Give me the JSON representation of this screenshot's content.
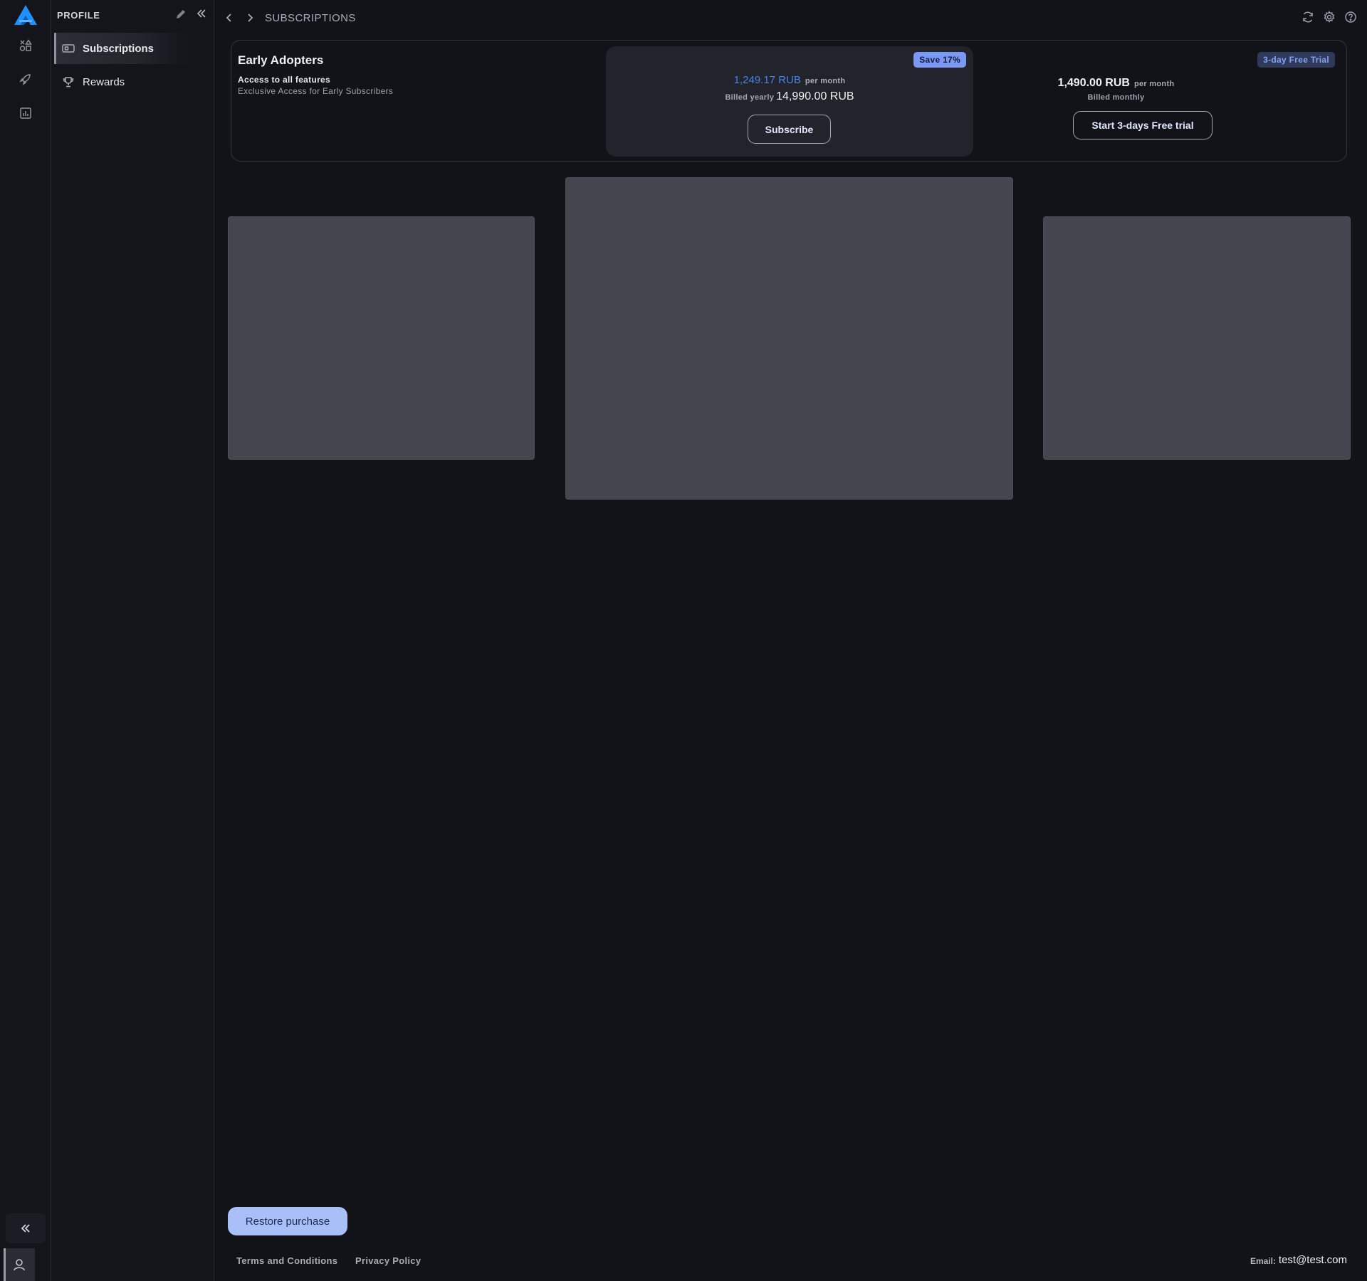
{
  "app": {
    "logo_icon": "app-logo-icon",
    "accent": "#1e90ff"
  },
  "rail": {
    "items": [
      {
        "name": "shapes-icon"
      },
      {
        "name": "rocket-icon"
      },
      {
        "name": "chart-icon"
      }
    ],
    "collapse_icon": "double-chevron-left-icon",
    "profile_icon": "user-icon"
  },
  "sidebar": {
    "title": "PROFILE",
    "items": [
      {
        "label": "Subscriptions",
        "icon": "ticket-icon",
        "active": true
      },
      {
        "label": "Rewards",
        "icon": "trophy-icon",
        "active": false
      }
    ]
  },
  "topbar": {
    "breadcrumb": "SUBSCRIPTIONS",
    "icons": [
      "refresh-icon",
      "gear-icon",
      "help-icon"
    ]
  },
  "plan": {
    "name": "Early Adopters",
    "features": "Access to all features",
    "description": "Exclusive Access for Early Subscribers",
    "yearly": {
      "badge": "Save 17%",
      "monthly_price": "1,249.17 RUB",
      "per_label": "per month",
      "billed_label": "Billed yearly",
      "billed_price": "14,990.00 RUB",
      "button": "Subscribe"
    },
    "monthly": {
      "badge": "3-day Free Trial",
      "price": "1,490.00 RUB",
      "per_label": "per month",
      "billed_label": "Billed monthly",
      "button": "Start 3-days Free trial"
    }
  },
  "footer": {
    "restore_button": "Restore purchase",
    "terms": "Terms and Conditions",
    "privacy": "Privacy Policy",
    "email_label": "Email:",
    "email": "test@test.com"
  }
}
